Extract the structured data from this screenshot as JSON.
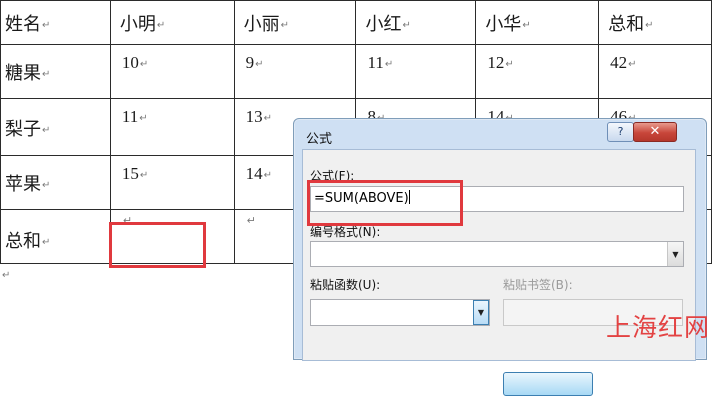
{
  "table": {
    "headers": [
      "姓名",
      "小明",
      "小丽",
      "小红",
      "小华",
      "总和"
    ],
    "rows": [
      {
        "name": "糖果",
        "values": [
          "10",
          "9",
          "11",
          "12",
          "42"
        ]
      },
      {
        "name": "梨子",
        "values": [
          "11",
          "13",
          "8",
          "14",
          "46"
        ]
      },
      {
        "name": "苹果",
        "values": [
          "15",
          "14",
          "",
          "",
          ""
        ]
      },
      {
        "name": "总和",
        "values": [
          "",
          "",
          "",
          "",
          ""
        ]
      }
    ],
    "paragraph_mark": "↵"
  },
  "dialog": {
    "title": "公式",
    "help_label": "?",
    "close_label": "✕",
    "formula_label": "公式(F):",
    "formula_value": "=SUM(ABOVE)",
    "number_format_label": "编号格式(N):",
    "number_format_value": "",
    "paste_function_label": "粘贴函数(U):",
    "paste_function_value": "",
    "paste_bookmark_label": "粘贴书签(B):",
    "paste_bookmark_value": "",
    "dropdown_arrow": "▼"
  },
  "highlight_color": "#e0393e",
  "watermark": "上海红网"
}
